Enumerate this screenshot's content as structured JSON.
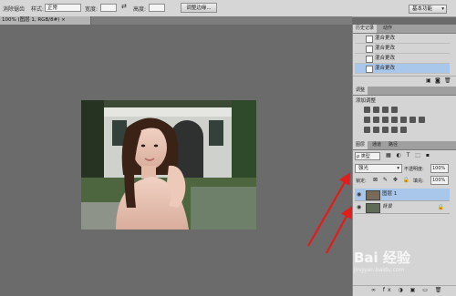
{
  "options_bar": {
    "tool_label": "消除锯齿",
    "style_label": "样式:",
    "style_value": "正常",
    "width_label": "宽度:",
    "height_label": "高度:",
    "refine_edge": "调整边缘...",
    "workspace": "基本功能"
  },
  "document_tab": {
    "title": "100% (图层 1, RGB/8#) ×"
  },
  "history_panel": {
    "tabs": [
      "历史记录",
      "动作"
    ],
    "items": [
      "混合更改",
      "混合更改",
      "混合更改",
      "混合更改"
    ]
  },
  "adjustments_panel": {
    "tab": "调整",
    "title": "添加调整"
  },
  "layers_panel": {
    "tabs": [
      "图层",
      "通道",
      "路径"
    ],
    "kind_filter": "ρ 类型",
    "blend_mode": "强光",
    "opacity_label": "不透明度:",
    "opacity_value": "100%",
    "lock_label": "锁定:",
    "fill_label": "填充:",
    "fill_value": "100%",
    "layers": [
      {
        "name": "图层 1",
        "selected": true
      },
      {
        "name": "背景",
        "selected": false
      }
    ]
  },
  "watermark": {
    "text": "Bai 经验",
    "sub": "jingyan.baidu.com"
  }
}
